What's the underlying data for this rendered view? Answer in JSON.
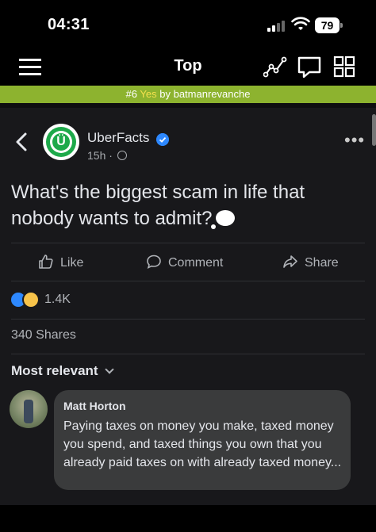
{
  "status_bar": {
    "time": "04:31",
    "battery": "79"
  },
  "app_bar": {
    "title": "Top"
  },
  "banner": {
    "prefix": "#6",
    "highlight": "Yes",
    "suffix": "by batmanrevanche"
  },
  "post": {
    "page_name": "UberFacts",
    "avatar_letter": "Ü",
    "time": "15h ·",
    "text": "What's the biggest scam in life that nobody wants to admit?",
    "actions": {
      "like": "Like",
      "comment": "Comment",
      "share": "Share"
    },
    "reaction_count": "1.4K",
    "shares": "340 Shares",
    "sort_label": "Most relevant"
  },
  "comment": {
    "author": "Matt Horton",
    "text": "Paying taxes on money you make, taxed money you spend, and taxed things you own that you already paid taxes on with already taxed money..."
  },
  "colors": {
    "banner": "#8db32f",
    "banner_highlight": "#f4e04d",
    "fb_background": "#18181b",
    "verified": "#2d88ff",
    "uberfacts_green": "#1da94a"
  }
}
